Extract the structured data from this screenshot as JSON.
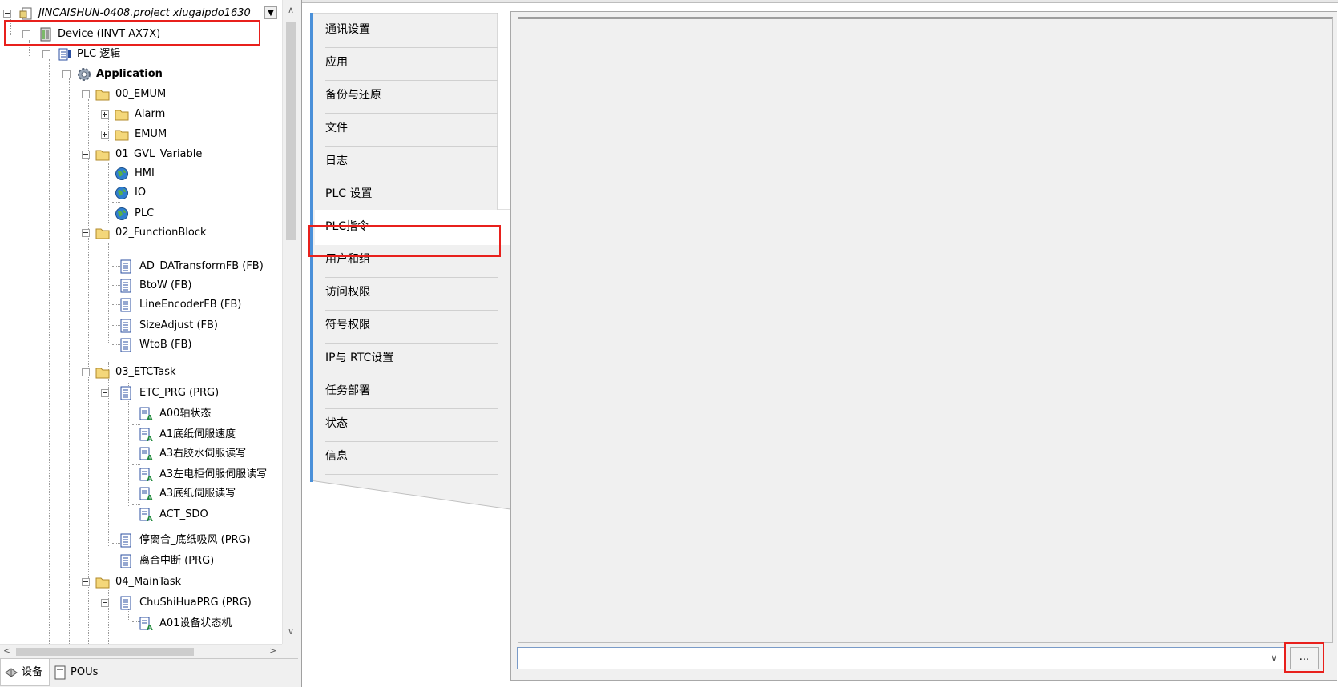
{
  "tree": {
    "root": {
      "label": "JINCAISHUN-0408.project xiugaipdo1630",
      "icon": "project-icon"
    },
    "device": {
      "label": "Device (INVT AX7X)",
      "icon": "device-icon"
    },
    "plc_logic": {
      "label": "PLC 逻辑",
      "icon": "plc-logic-icon"
    },
    "application": {
      "label": "Application",
      "icon": "gear-icon"
    },
    "items": [
      {
        "label": "00_EMUM",
        "icon": "folder-icon"
      },
      {
        "label": "Alarm",
        "icon": "folder-icon"
      },
      {
        "label": "EMUM",
        "icon": "folder-icon"
      },
      {
        "label": "01_GVL_Variable",
        "icon": "folder-icon"
      },
      {
        "label": "HMI",
        "icon": "globe-icon"
      },
      {
        "label": "IO",
        "icon": "globe-icon"
      },
      {
        "label": "PLC",
        "icon": "globe-icon"
      },
      {
        "label": "02_FunctionBlock",
        "icon": "folder-icon"
      },
      {
        "label": "AD_DATransformFB (FB)",
        "icon": "document-icon"
      },
      {
        "label": "BtoW (FB)",
        "icon": "document-icon"
      },
      {
        "label": "LineEncoderFB (FB)",
        "icon": "document-icon"
      },
      {
        "label": "SizeAdjust (FB)",
        "icon": "document-icon"
      },
      {
        "label": "WtoB (FB)",
        "icon": "document-icon"
      },
      {
        "label": "03_ETCTask",
        "icon": "folder-icon"
      },
      {
        "label": "ETC_PRG (PRG)",
        "icon": "document-icon"
      },
      {
        "label": "A00轴状态",
        "icon": "action-icon"
      },
      {
        "label": "A1底纸伺服速度",
        "icon": "action-icon"
      },
      {
        "label": "A3右胶水伺服读写",
        "icon": "action-icon"
      },
      {
        "label": "A3左电柜伺服伺服读写",
        "icon": "action-icon"
      },
      {
        "label": "A3底纸伺服读写",
        "icon": "action-icon"
      },
      {
        "label": "ACT_SDO",
        "icon": "action-icon"
      },
      {
        "label": "停离合_底纸吸风 (PRG)",
        "icon": "document-icon"
      },
      {
        "label": "离合中断 (PRG)",
        "icon": "document-icon"
      },
      {
        "label": "04_MainTask",
        "icon": "folder-icon"
      },
      {
        "label": "ChuShiHuaPRG (PRG)",
        "icon": "document-icon"
      },
      {
        "label": "A01设备状态机",
        "icon": "action-icon"
      }
    ]
  },
  "bottom_tabs": [
    {
      "label": "设备",
      "icon": "devices-icon"
    },
    {
      "label": "POUs",
      "icon": "pou-icon"
    }
  ],
  "nav": {
    "items": [
      "通讯设置",
      "应用",
      "备份与还原",
      "文件",
      "日志",
      "PLC 设置",
      "PLC指令",
      "用户和组",
      "访问权限",
      "符号权限",
      "IP与 RTC设置",
      "任务部署",
      "状态",
      "信息"
    ],
    "active": "PLC指令"
  },
  "command": {
    "value": "",
    "browse_label": "..."
  },
  "colors": {
    "highlight": "#e8201c",
    "nav_accent": "#4a90d9"
  }
}
